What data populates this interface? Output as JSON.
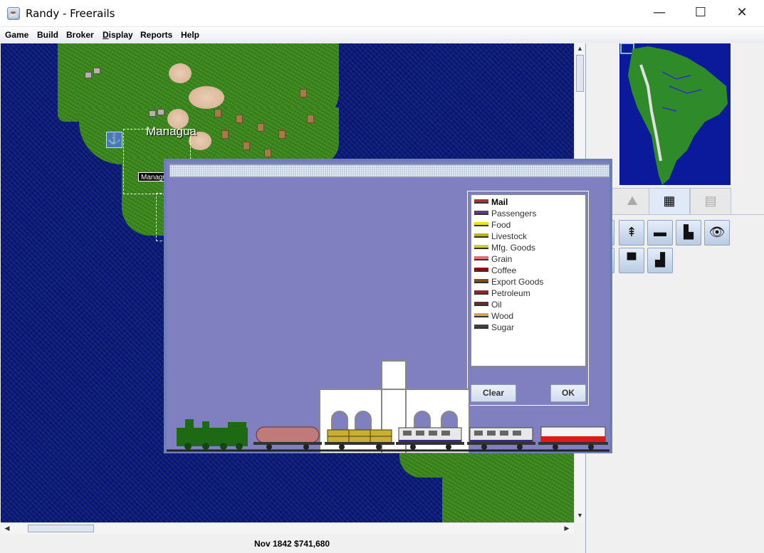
{
  "window": {
    "title": "Randy - Freerails",
    "icon": "java-cup-icon",
    "controls": {
      "minimize": "—",
      "maximize": "☐",
      "close": "✕"
    }
  },
  "menubar": {
    "items": [
      "Game",
      "Build",
      "Broker",
      "Display",
      "Reports",
      "Help"
    ]
  },
  "map": {
    "city_name": "Managua",
    "station_tag": "Managua",
    "anchor_icon": "⚓",
    "colors": {
      "sea": "#0a1a7a",
      "land": "#3c8a1e",
      "desert": "#e2c3a8"
    }
  },
  "dialog": {
    "title": "",
    "background": "#8080c0",
    "cargo_list": [
      {
        "label": "Mail",
        "color": "#b03030",
        "selected": true
      },
      {
        "label": "Passengers",
        "color": "#5a3f7a",
        "selected": false
      },
      {
        "label": "Food",
        "color": "#e8e800",
        "selected": false
      },
      {
        "label": "Livestock",
        "color": "#b8b800",
        "selected": false
      },
      {
        "label": "Mfg. Goods",
        "color": "#cfcf30",
        "selected": false
      },
      {
        "label": "Grain",
        "color": "#e07070",
        "selected": false
      },
      {
        "label": "Coffee",
        "color": "#9a0000",
        "selected": false
      },
      {
        "label": "Export Goods",
        "color": "#8a4a10",
        "selected": false
      },
      {
        "label": "Petroleum",
        "color": "#8a2a2a",
        "selected": false
      },
      {
        "label": "Oil",
        "color": "#5a3030",
        "selected": false
      },
      {
        "label": "Wood",
        "color": "#e0a050",
        "selected": false
      },
      {
        "label": "Sugar",
        "color": "#404040",
        "selected": false
      }
    ],
    "buttons": {
      "clear": "Clear",
      "ok": "OK"
    },
    "train_cars": [
      "locomotive",
      "tank-car",
      "cargo-car",
      "passenger-car",
      "passenger-car",
      "tanker-red-car"
    ]
  },
  "right_panel": {
    "tabs": [
      {
        "icon": "build-tab-icon",
        "glyph": "⛰",
        "active": false
      },
      {
        "icon": "track-tab-icon",
        "glyph": "▦",
        "active": true
      },
      {
        "icon": "train-tab-icon",
        "glyph": "▤",
        "active": false
      }
    ],
    "tools": [
      {
        "name": "track-tool",
        "glyph": "╪"
      },
      {
        "name": "bridge-tool",
        "glyph": "⇞"
      },
      {
        "name": "station-tool",
        "glyph": "▬"
      },
      {
        "name": "train-tool",
        "glyph": "▙"
      },
      {
        "name": "eye-tool",
        "glyph": "👁"
      },
      {
        "name": "sign-tool",
        "glyph": "┴"
      },
      {
        "name": "depot-tool",
        "glyph": "▀"
      },
      {
        "name": "terminal-tool",
        "glyph": "▟"
      }
    ]
  },
  "statusbar": {
    "text": "Nov 1842 $741,680"
  }
}
